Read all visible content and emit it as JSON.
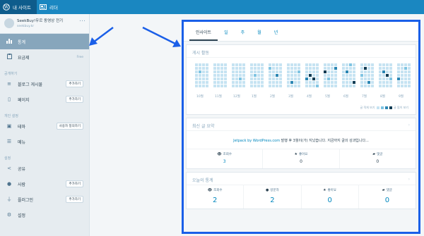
{
  "topbar": {
    "my_sites": "내 사이트",
    "reader": "리더"
  },
  "site": {
    "name": "SeekBuy!우르 동영상 전기",
    "url": "seekbuy.kr"
  },
  "sidebar": {
    "items": [
      {
        "label": "통계",
        "icon": "bar-chart-icon",
        "active": true
      },
      {
        "label": "요금제",
        "icon": "clipboard-icon",
        "badge": "Free"
      }
    ],
    "sections": [
      {
        "heading": "공개하기",
        "items": [
          {
            "label": "블로그 게시물",
            "icon": "document-icon",
            "button": "추가하기"
          },
          {
            "label": "페이지",
            "icon": "page-icon",
            "button": "추가하기"
          }
        ]
      },
      {
        "heading": "개인 설정",
        "items": [
          {
            "label": "테마",
            "icon": "theme-icon",
            "button": "사용자 정의하기"
          },
          {
            "label": "메뉴",
            "icon": "menu-icon"
          }
        ]
      },
      {
        "heading": "설정",
        "items": [
          {
            "label": "공유",
            "icon": "share-icon"
          },
          {
            "label": "사람",
            "icon": "person-icon",
            "button": "추가하기"
          },
          {
            "label": "플러그인",
            "icon": "plug-icon",
            "button": "추가하기"
          },
          {
            "label": "설정",
            "icon": "gear-icon"
          }
        ]
      }
    ]
  },
  "tabs": [
    "인사이트",
    "일",
    "주",
    "월",
    "년"
  ],
  "post_activity": {
    "title": "게시 활동",
    "months": [
      "10월",
      "11월",
      "12월",
      "1월",
      "2월",
      "3월",
      "4월",
      "5월",
      "6월",
      "7월",
      "8월",
      "9월"
    ],
    "legend_less": "글 적게 보기",
    "legend_more": "글 많이 보기"
  },
  "recent_post": {
    "title": "최신 글 요약",
    "link_text": "Jetpack by WordPress.com",
    "summary": " 발행 후 3월이(가) 지났습니다. 지금까지 글의 성과입니다...",
    "stats": [
      {
        "label": "조회수",
        "value": "3",
        "icon": "eye-icon"
      },
      {
        "label": "좋아요",
        "value": "0",
        "icon": "star-icon"
      },
      {
        "label": "댓글",
        "value": "0",
        "icon": "comment-icon"
      }
    ]
  },
  "today": {
    "title": "오늘의 통계",
    "stats": [
      {
        "label": "조회수",
        "value": "2",
        "icon": "eye-icon"
      },
      {
        "label": "방문자",
        "value": "2",
        "icon": "person-icon"
      },
      {
        "label": "좋아요",
        "value": "0",
        "icon": "star-icon"
      },
      {
        "label": "댓글",
        "value": "0",
        "icon": "comment-icon"
      }
    ]
  },
  "colors": {
    "topbar": "#1a87c1",
    "highlight_border": "#1a5fe8",
    "heat_empty": "#c6e3f2",
    "heat_low": "#7fc4e2",
    "heat_mid": "#2b86b3",
    "heat_high": "#0f3c54"
  }
}
